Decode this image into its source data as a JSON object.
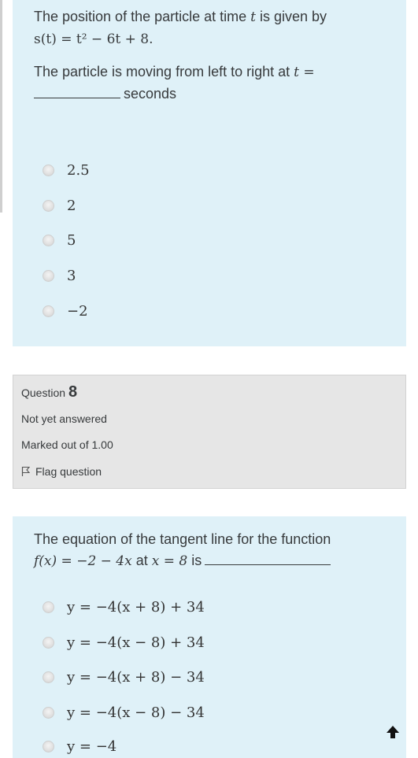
{
  "q7": {
    "line1_text": "The position of the particle at time ",
    "line1_var": "t",
    "line1_end": " is given by",
    "equation": "s(t) = t² − 6t + 8.",
    "prompt_text": "The particle is moving from left to right at ",
    "prompt_var": "t",
    "prompt_eq": " =",
    "units": "seconds",
    "options": [
      "2.5",
      "2",
      "5",
      "3",
      "−2"
    ]
  },
  "q8": {
    "question_label": "Question",
    "question_number": "8",
    "status": "Not yet answered",
    "marks": "Marked out of 1.00",
    "flag_label": "Flag question",
    "text": "The equation of the tangent line for the function",
    "func": "f(x) = −2 − 4x",
    "at_text": " at ",
    "at_eq": "x = 8",
    "is_text": " is",
    "options": [
      "y = −4(x + 8) + 34",
      "y = −4(x − 8) + 34",
      "y = −4(x + 8) − 34",
      "y = −4(x − 8) − 34",
      "y = −4"
    ]
  },
  "icons": {
    "radio": "radio-unchecked-icon",
    "flag": "flag-icon",
    "scroll_top": "arrow-up-icon"
  }
}
